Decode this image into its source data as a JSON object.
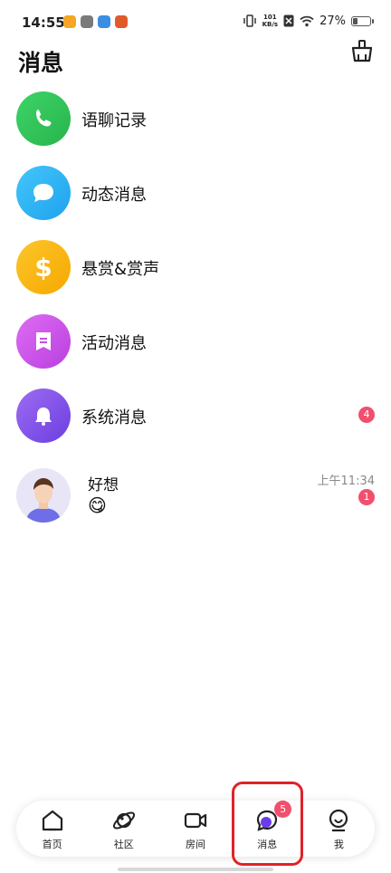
{
  "status_bar": {
    "time": "14:55",
    "net_speed_value": "101",
    "net_speed_unit": "KB/s",
    "battery_percent": "27%",
    "battery_level": 0.27
  },
  "header": {
    "title": "消息",
    "clear_icon": "broom-icon"
  },
  "menu": [
    {
      "label": "语聊记录",
      "icon": "phone-icon",
      "color": "#35c85a"
    },
    {
      "label": "动态消息",
      "icon": "chat-bubble-icon",
      "color": "#2bb4f5"
    },
    {
      "label": "悬赏&赏声",
      "icon": "dollar-icon",
      "color": "#fbb414"
    },
    {
      "label": "活动消息",
      "icon": "bookmark-icon",
      "color": "#d056e8"
    },
    {
      "label": "系统消息",
      "icon": "bell-icon",
      "color": "#8655e8",
      "badge": "4"
    }
  ],
  "chat": {
    "name": "好想",
    "emoji": "😋",
    "time": "上午11:34",
    "badge": "1"
  },
  "bottom_nav": {
    "home": "首页",
    "community": "社区",
    "rooms": "房间",
    "messages": "消息",
    "messages_badge": "5",
    "me": "我"
  },
  "colors": {
    "accent": "#6a3de8",
    "badge": "#f0506e",
    "highlight": "#e0222a"
  }
}
